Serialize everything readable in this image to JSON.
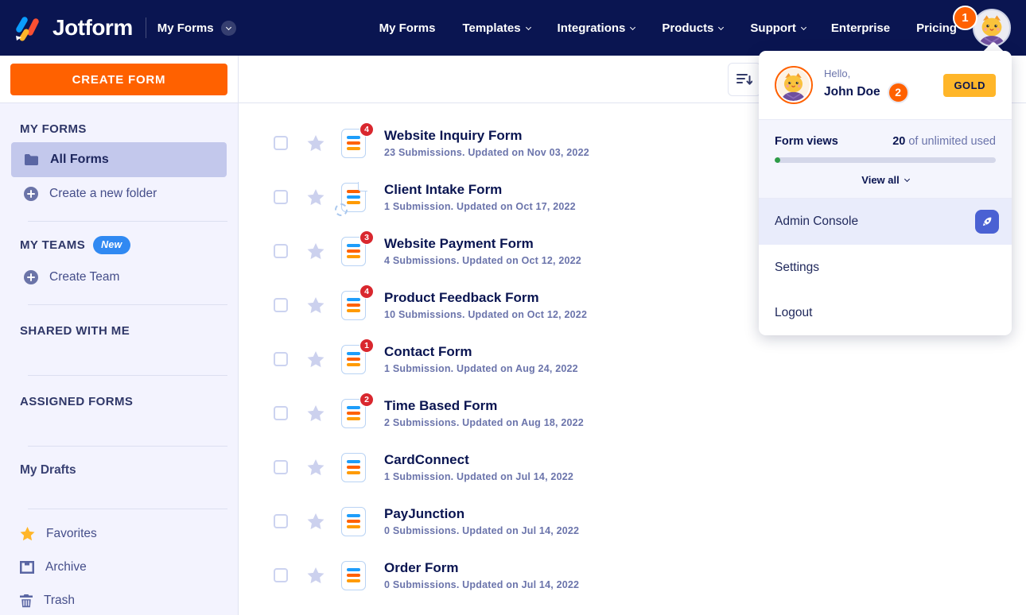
{
  "navbar": {
    "brand": "Jotform",
    "context": "My Forms",
    "items": [
      {
        "label": "My Forms"
      },
      {
        "label": "Templates"
      },
      {
        "label": "Integrations"
      },
      {
        "label": "Products"
      },
      {
        "label": "Support"
      },
      {
        "label": "Enterprise"
      },
      {
        "label": "Pricing"
      }
    ],
    "notification_count": "1"
  },
  "sidebar": {
    "create_form": "CREATE FORM",
    "my_forms_header": "MY FORMS",
    "all_forms": "All Forms",
    "create_folder": "Create a new folder",
    "my_teams_header": "MY TEAMS",
    "new_badge": "New",
    "create_team": "Create Team",
    "shared_header": "SHARED WITH ME",
    "assigned_header": "ASSIGNED FORMS",
    "my_drafts": "My Drafts",
    "favorites": "Favorites",
    "archive": "Archive",
    "trash": "Trash"
  },
  "forms": [
    {
      "name": "Website Inquiry Form",
      "badge": "4",
      "meta": "23 Submissions. Updated on Nov 03, 2022"
    },
    {
      "name": "Client Intake Form",
      "badge": "",
      "meta": "1 Submission. Updated on Oct 17, 2022"
    },
    {
      "name": "Website Payment Form",
      "badge": "3",
      "meta": "4 Submissions. Updated on Oct 12, 2022"
    },
    {
      "name": "Product Feedback Form",
      "badge": "4",
      "meta": "10 Submissions. Updated on Oct 12, 2022"
    },
    {
      "name": "Contact Form",
      "badge": "1",
      "meta": "1 Submission. Updated on Aug 24, 2022"
    },
    {
      "name": "Time Based Form",
      "badge": "2",
      "meta": "2 Submissions. Updated on Aug 18, 2022"
    },
    {
      "name": "CardConnect",
      "badge": "",
      "meta": "1 Submission. Updated on Jul 14, 2022"
    },
    {
      "name": "PayJunction",
      "badge": "",
      "meta": "0 Submissions. Updated on Jul 14, 2022"
    },
    {
      "name": "Order Form",
      "badge": "",
      "meta": "0 Submissions. Updated on Jul 14, 2022"
    }
  ],
  "user_menu": {
    "hello": "Hello,",
    "name": "John Doe",
    "badge": "2",
    "plan": "GOLD",
    "usage_label": "Form views",
    "usage_value": "20",
    "usage_suffix": " of unlimited used",
    "view_all": "View all",
    "admin_console": "Admin Console",
    "settings": "Settings",
    "logout": "Logout"
  },
  "colors": {
    "navbar_navy": "#0a1551",
    "brand_orange": "#ff6100",
    "gold_badge": "#ffb629",
    "notification_red": "#d9272e",
    "new_badge_blue": "#3089f2",
    "progress_green": "#2e9c47",
    "sidebar_bg": "#f3f3fe",
    "selected_item_bg": "#c3c8ec"
  }
}
